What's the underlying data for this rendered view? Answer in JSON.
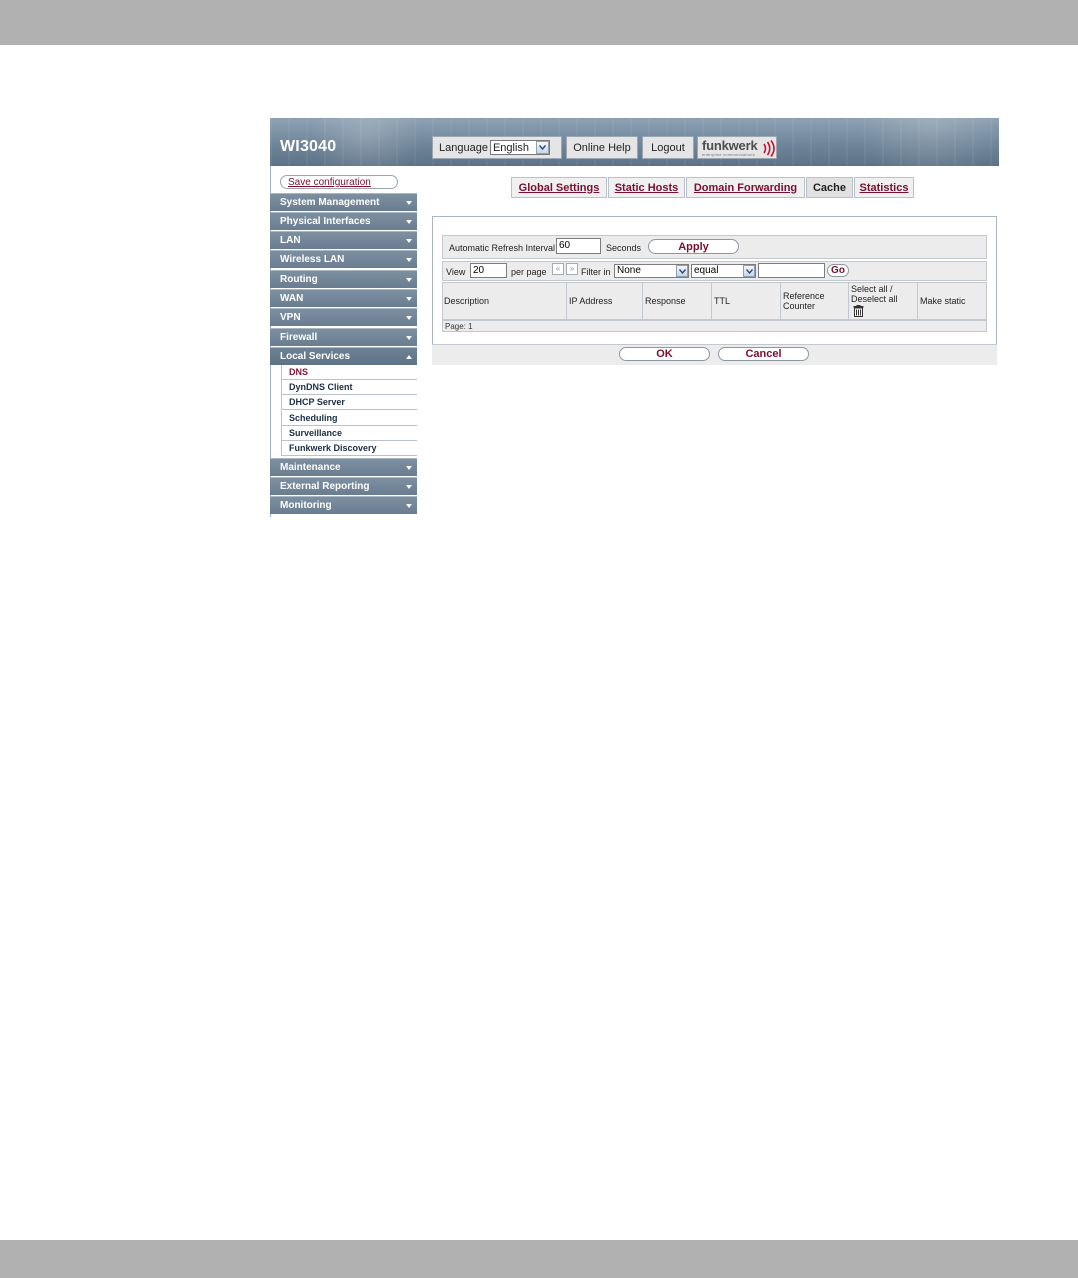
{
  "header": {
    "product_title": "WI3040",
    "language_label": "Language",
    "language_value": "English",
    "online_help": "Online Help",
    "logout": "Logout",
    "brand_name": "funkwerk",
    "brand_tagline": "enterprise communications"
  },
  "sidebar": {
    "save_configuration": "Save configuration",
    "items": [
      {
        "label": "System Management",
        "state": "collapsed"
      },
      {
        "label": "Physical Interfaces",
        "state": "collapsed"
      },
      {
        "label": "LAN",
        "state": "collapsed"
      },
      {
        "label": "Wireless LAN",
        "state": "collapsed"
      },
      {
        "label": "Routing",
        "state": "collapsed"
      },
      {
        "label": "WAN",
        "state": "collapsed"
      },
      {
        "label": "VPN",
        "state": "collapsed"
      },
      {
        "label": "Firewall",
        "state": "collapsed"
      },
      {
        "label": "Local Services",
        "state": "expanded"
      },
      {
        "label": "Maintenance",
        "state": "collapsed"
      },
      {
        "label": "External Reporting",
        "state": "collapsed"
      },
      {
        "label": "Monitoring",
        "state": "collapsed"
      }
    ],
    "sub_items": [
      {
        "label": "DNS",
        "active": true
      },
      {
        "label": "DynDNS Client",
        "active": false
      },
      {
        "label": "DHCP Server",
        "active": false
      },
      {
        "label": "Scheduling",
        "active": false
      },
      {
        "label": "Surveillance",
        "active": false
      },
      {
        "label": "Funkwerk Discovery",
        "active": false
      }
    ]
  },
  "tabs": [
    {
      "label": "Global Settings",
      "active": false
    },
    {
      "label": "Static Hosts",
      "active": false
    },
    {
      "label": "Domain Forwarding",
      "active": false
    },
    {
      "label": "Cache",
      "active": true
    },
    {
      "label": "Statistics",
      "active": false
    }
  ],
  "refresh": {
    "label": "Automatic Refresh Interval",
    "value": "60",
    "unit": "Seconds",
    "apply": "Apply"
  },
  "filter": {
    "view_label": "View",
    "view_value": "20",
    "per_page": "per page",
    "prev_icon": "«",
    "next_icon": "»",
    "filter_in": "Filter in",
    "field_value": "None",
    "operator_value": "equal",
    "search_value": "",
    "go": "Go"
  },
  "table": {
    "columns": [
      "Description",
      "IP Address",
      "Response",
      "TTL",
      "Reference Counter",
      "Select all / Deselect all",
      "Make static"
    ],
    "rows": [],
    "pager": "Page: 1"
  },
  "footer": {
    "ok": "OK",
    "cancel": "Cancel"
  },
  "colors": {
    "accent": "#7a0e2e",
    "nav": "#6a7d90"
  },
  "icons": {
    "trash": "trash-icon",
    "dropdown": "chevron-down-icon",
    "nav_collapsed": "triangle-down-icon",
    "nav_expanded": "triangle-up-icon"
  }
}
